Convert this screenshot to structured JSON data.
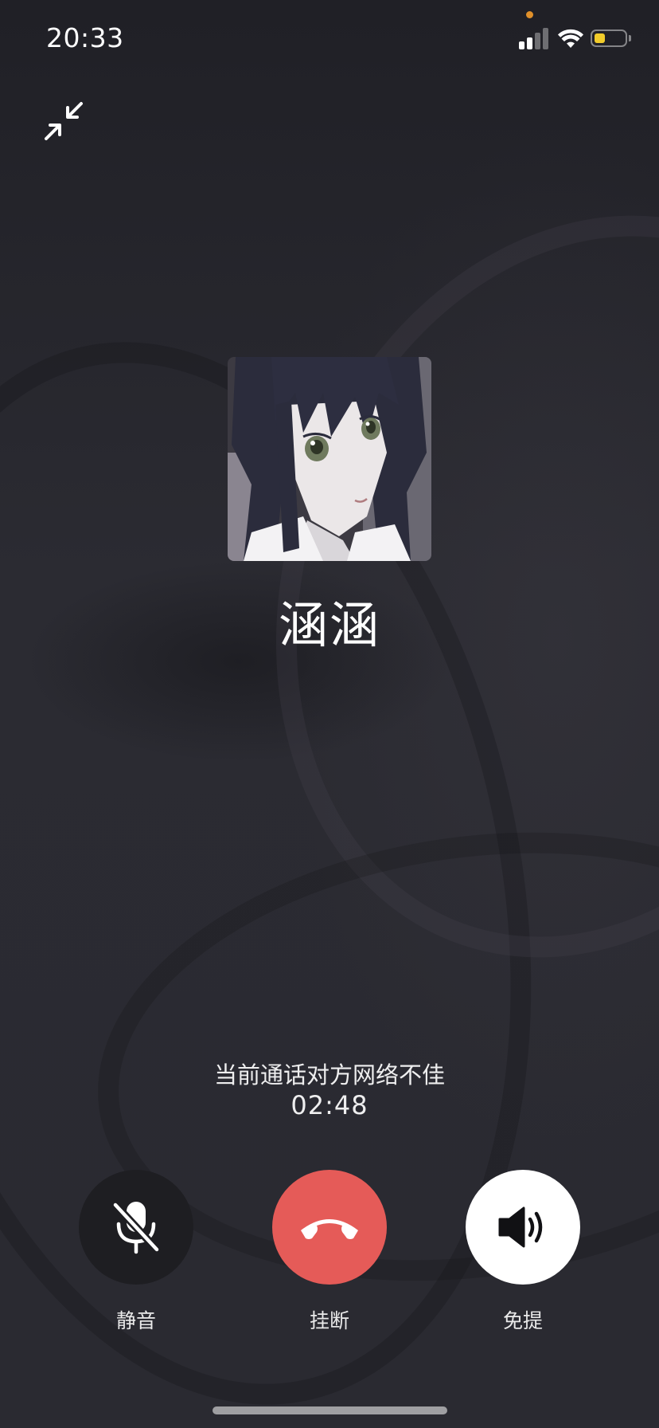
{
  "status_bar": {
    "time": "20:33",
    "battery_level": 0.35,
    "battery_color": "#f2cc2b",
    "privacy_dot_color": "#e0902a",
    "signal_bars_active": 2,
    "signal_bars_total": 4
  },
  "top_controls": {
    "minimize_icon": "minimize-arrows-icon"
  },
  "caller": {
    "name": "涵涵",
    "avatar_icon": "anime-girl-avatar"
  },
  "call": {
    "status_text": "当前通话对方网络不佳",
    "duration": "02:48"
  },
  "controls": {
    "mute": {
      "label": "静音",
      "icon": "mic-off-icon"
    },
    "hangup": {
      "label": "挂断",
      "icon": "phone-hangup-icon",
      "color": "#e55b58"
    },
    "speaker": {
      "label": "免提",
      "icon": "speaker-icon"
    }
  }
}
